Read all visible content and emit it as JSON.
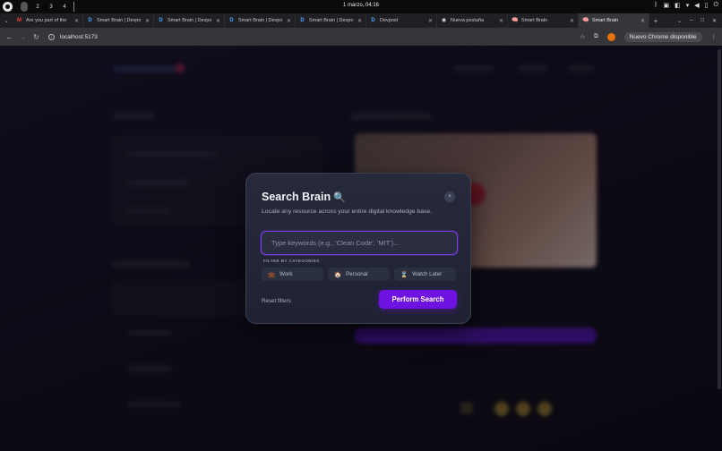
{
  "os": {
    "workspaces": [
      "",
      "2",
      "3",
      "4"
    ],
    "clock": "1 marzo, 04:16"
  },
  "tabs": [
    {
      "icon": "gmail-icon",
      "glyph": "M",
      "title": "Are you part of the",
      "active": false
    },
    {
      "icon": "devpost-icon",
      "glyph": "D",
      "title": "Smart Brain | Devpo",
      "active": false
    },
    {
      "icon": "devpost-icon",
      "glyph": "D",
      "title": "Smart Brain | Devpo",
      "active": false
    },
    {
      "icon": "devpost-icon",
      "glyph": "D",
      "title": "Smart Brain | Devpo",
      "active": false
    },
    {
      "icon": "devpost-icon",
      "glyph": "D",
      "title": "Smart Brain | Devpo",
      "active": false
    },
    {
      "icon": "devpost-icon",
      "glyph": "D",
      "title": "Devpost",
      "active": false
    },
    {
      "icon": "chrome-icon",
      "glyph": "◉",
      "title": "Nueva pestaña",
      "active": false
    },
    {
      "icon": "brain-icon",
      "glyph": "🧠",
      "title": "Smart Brain",
      "active": false
    },
    {
      "icon": "brain-icon",
      "glyph": "🧠",
      "title": "Smart Brain",
      "active": true
    }
  ],
  "addressbar": {
    "url": "localhost:5173",
    "update_label": "Nuevo Chrome disponible"
  },
  "modal": {
    "title": "Search Brain",
    "subtitle": "Locate any resource across your entire digital knowledge base.",
    "search_placeholder": "Type keywords (e.g., 'Clean Code', 'MIT')...",
    "search_value": "",
    "filter_label": "FILTER BY CATEGORIES",
    "categories": [
      {
        "icon": "briefcase-icon",
        "label": "Work"
      },
      {
        "icon": "house-icon",
        "label": "Personal"
      },
      {
        "icon": "hourglass-icon",
        "label": "Watch Later"
      }
    ],
    "reset_label": "Reset filters",
    "search_button_label": "Perform Search",
    "close_label": "×"
  },
  "colors": {
    "accent": "#6d12e0",
    "input_border": "#7c3aed",
    "modal_bg": "#262a3b"
  }
}
